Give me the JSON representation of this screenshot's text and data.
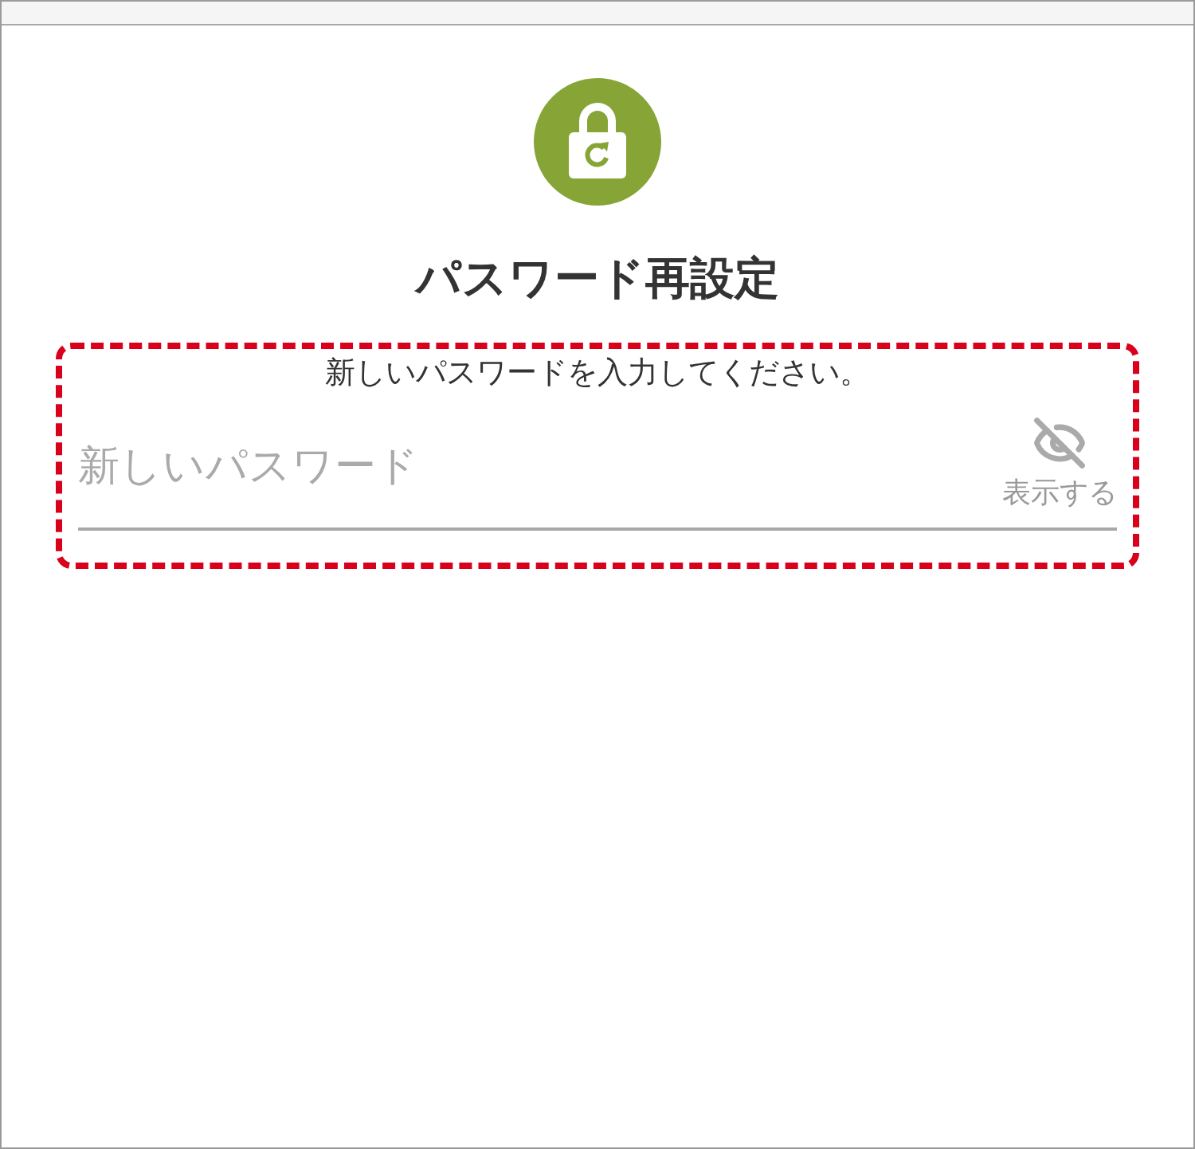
{
  "title": "パスワード再設定",
  "instruction": "新しいパスワードを入力してください。",
  "password_field": {
    "placeholder": "新しいパスワード",
    "toggle_label": "表示する"
  }
}
